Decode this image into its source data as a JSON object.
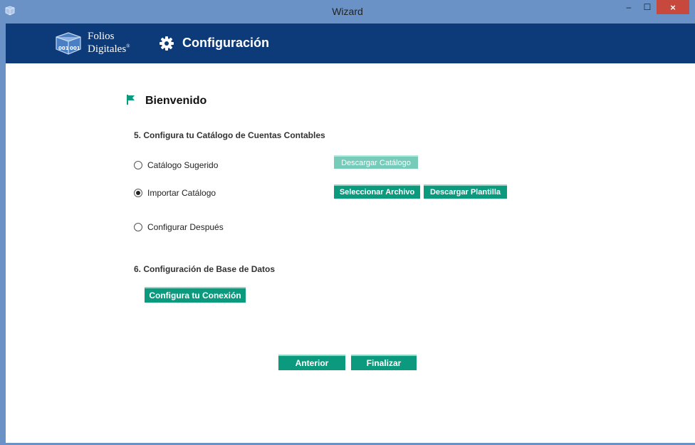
{
  "window": {
    "title": "Wizard",
    "minimize": "–",
    "maximize": "☐",
    "close": "×"
  },
  "header": {
    "logo_line1": "Folios",
    "logo_line2": "Digitales",
    "logo_mark": "®",
    "title": "Configuración"
  },
  "welcome": "Bienvenido",
  "section5": {
    "title": "5. Configura tu Catálogo de Cuentas Contables",
    "options": [
      {
        "label": "Catálogo Sugerido",
        "selected": false
      },
      {
        "label": "Importar Catálogo",
        "selected": true
      },
      {
        "label": "Configurar Después",
        "selected": false
      }
    ],
    "download_catalog": "Descargar Catálogo",
    "select_file": "Seleccionar Archivo",
    "download_template": "Descargar Plantilla"
  },
  "section6": {
    "title": "6. Configuración de Base de Datos",
    "configure_connection": "Configura tu Conexión"
  },
  "nav": {
    "previous": "Anterior",
    "finish": "Finalizar"
  },
  "colors": {
    "titlebar": "#6b92c6",
    "header": "#0d3a78",
    "button": "#0b9a7d",
    "button_disabled": "#77cbb9",
    "flag": "#0b9a7d",
    "close": "#c7483d"
  }
}
